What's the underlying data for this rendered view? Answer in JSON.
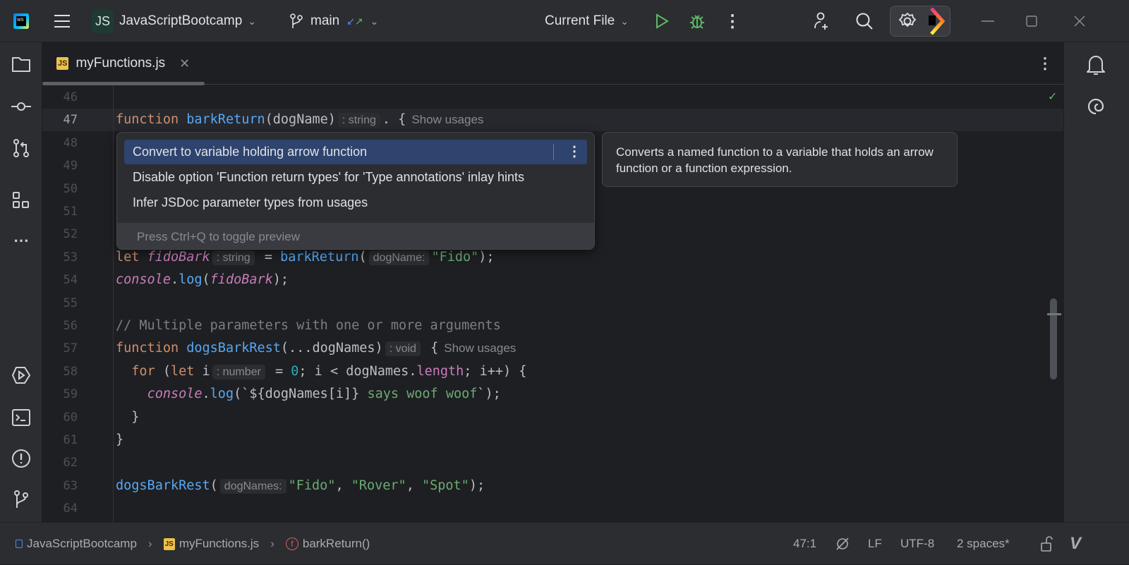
{
  "titlebar": {
    "project_badge": "JS",
    "project_name": "JavaScriptBootcamp",
    "branch": "main",
    "run_config": "Current File",
    "icons": [
      "webstorm-logo-icon",
      "hamburger-menu-icon",
      "branch-icon",
      "run-icon",
      "debug-icon",
      "more-icon",
      "add-user-icon",
      "search-icon",
      "settings-icon",
      "ai-assistant-icon",
      "minimize-icon",
      "maximize-icon",
      "close-icon"
    ]
  },
  "tab": {
    "badge": "JS",
    "label": "myFunctions.js"
  },
  "left_toolbar": [
    "project-icon",
    "commit-icon",
    "pull-requests-icon",
    "structure-icon",
    "more-icon",
    "run-icon",
    "terminal-icon",
    "problems-icon",
    "git-icon"
  ],
  "right_toolbar": [
    "notifications-icon",
    "ai-icon"
  ],
  "editor": {
    "current_line": 47,
    "lines": [
      {
        "n": "46",
        "t": []
      },
      {
        "n": "47",
        "t": [
          [
            "kw",
            "function "
          ],
          [
            "fn",
            "barkReturn"
          ],
          [
            "",
            "(dogName)"
          ],
          [
            "hint",
            ": string"
          ],
          [
            "",
            ". {"
          ],
          [
            "usage",
            "Show usages"
          ]
        ]
      },
      {
        "n": "48",
        "t": []
      },
      {
        "n": "49",
        "t": []
      },
      {
        "n": "50",
        "t": []
      },
      {
        "n": "51",
        "t": []
      },
      {
        "n": "52",
        "t": []
      },
      {
        "n": "53",
        "t": [
          [
            "kw",
            "let "
          ],
          [
            "it",
            "fidoBark"
          ],
          [
            "hint",
            ": string"
          ],
          [
            "",
            " = "
          ],
          [
            "fn",
            "barkReturn"
          ],
          [
            "",
            "("
          ],
          [
            "hint",
            "dogName:"
          ],
          [
            "str",
            "\"Fido\""
          ],
          [
            "",
            ");"
          ]
        ]
      },
      {
        "n": "54",
        "t": [
          [
            "it",
            "console"
          ],
          [
            "",
            "."
          ],
          [
            "fn",
            "log"
          ],
          [
            "",
            "("
          ],
          [
            "it",
            "fidoBark"
          ],
          [
            "",
            ");"
          ]
        ]
      },
      {
        "n": "55",
        "t": []
      },
      {
        "n": "56",
        "t": [
          [
            "cm",
            "// Multiple parameters with one or more arguments"
          ]
        ]
      },
      {
        "n": "57",
        "t": [
          [
            "kw",
            "function "
          ],
          [
            "fn",
            "dogsBarkRest"
          ],
          [
            "",
            "(...dogNames)"
          ],
          [
            "hint",
            ": void"
          ],
          [
            "",
            " {"
          ],
          [
            "usage",
            "Show usages"
          ]
        ]
      },
      {
        "n": "58",
        "t": [
          [
            "",
            "  "
          ],
          [
            "kw",
            "for "
          ],
          [
            "",
            "("
          ],
          [
            "kw",
            "let "
          ],
          [
            "",
            "i"
          ],
          [
            "hint",
            ": number"
          ],
          [
            "",
            " = "
          ],
          [
            "num",
            "0"
          ],
          [
            "",
            "; i < dogNames."
          ],
          [
            "prop",
            "length"
          ],
          [
            "",
            "; i++) {"
          ]
        ]
      },
      {
        "n": "59",
        "t": [
          [
            "",
            "    "
          ],
          [
            "it",
            "console"
          ],
          [
            "",
            "."
          ],
          [
            "fn",
            "log"
          ],
          [
            "",
            "(`${dogNames[i]}"
          ],
          [
            "str",
            " says woof woof"
          ],
          [
            "",
            "`);"
          ]
        ]
      },
      {
        "n": "60",
        "t": [
          [
            "",
            "  }"
          ]
        ]
      },
      {
        "n": "61",
        "t": [
          [
            "",
            "}"
          ]
        ]
      },
      {
        "n": "62",
        "t": []
      },
      {
        "n": "63",
        "t": [
          [
            "fn",
            "dogsBarkRest"
          ],
          [
            "",
            "("
          ],
          [
            "hint",
            "dogNames:"
          ],
          [
            "str",
            "\"Fido\""
          ],
          [
            "",
            ", "
          ],
          [
            "str",
            "\"Rover\""
          ],
          [
            "",
            ", "
          ],
          [
            "str",
            "\"Spot\""
          ],
          [
            "",
            ");"
          ]
        ]
      },
      {
        "n": "64",
        "t": []
      }
    ]
  },
  "popup": {
    "items": [
      "Convert to variable holding arrow function",
      "Disable option 'Function return types' for 'Type annotations' inlay hints",
      "Infer JSDoc parameter types from usages"
    ],
    "selected_index": 0,
    "footer": "Press Ctrl+Q to toggle preview"
  },
  "tooltip": {
    "text": "Converts a named function to a variable that holds an arrow function or a function expression."
  },
  "statusbar": {
    "breadcrumb": [
      "JavaScriptBootcamp",
      "myFunctions.js",
      "barkReturn()"
    ],
    "js_badge": "JS",
    "position": "47:1",
    "line_ending": "LF",
    "encoding": "UTF-8",
    "indent": "2 spaces*"
  },
  "colors": {
    "accent": "#2e436e",
    "keyword": "#cf8e6d",
    "function": "#56a8f5",
    "string": "#6aab73",
    "run": "#5fb865"
  }
}
